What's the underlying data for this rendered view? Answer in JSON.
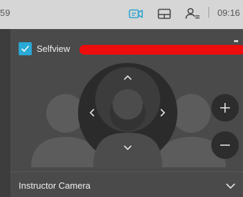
{
  "statusbar": {
    "left_text": "59",
    "clock": "09:16",
    "icons": [
      "camera-icon",
      "layout-icon",
      "participants-icon"
    ]
  },
  "selfview": {
    "label": "Selfview",
    "checked": true
  },
  "camera": {
    "name": "Instructor Camera",
    "controls": [
      "pan-up",
      "pan-down",
      "pan-left",
      "pan-right",
      "zoom-in",
      "zoom-out"
    ]
  },
  "colors": {
    "accent": "#29a9d6",
    "redaction": "#ee0d0d",
    "panel": "#4a4a4a",
    "statusbar": "#d6d6d6"
  }
}
